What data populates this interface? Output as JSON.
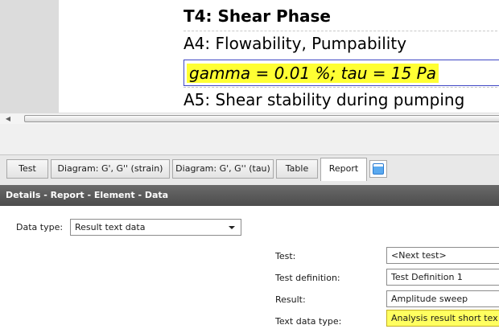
{
  "report_preview": {
    "lines": {
      "title": "T4: Shear Phase",
      "a4": "A4: Flowability, Pumpability",
      "gamma": "gamma = 0.01 %; tau = 15 Pa",
      "a5": "A5: Shear stability during pumping"
    },
    "highlight_color": "#ffff33",
    "selection_color": "#3e46c4"
  },
  "tabs": [
    {
      "label": "Test",
      "active": false
    },
    {
      "label": "Diagram: G', G'' (strain)",
      "active": false
    },
    {
      "label": "Diagram: G', G'' (tau)",
      "active": false
    },
    {
      "label": "Table",
      "active": false
    },
    {
      "label": "Report",
      "active": true
    }
  ],
  "add_tab_icon": "window-icon",
  "details_header": "Details - Report - Element - Data",
  "details": {
    "data_type_label": "Data type:",
    "data_type_value": "Result text data",
    "fields": [
      {
        "label": "Test:",
        "value": "<Next test>"
      },
      {
        "label": "Test definition:",
        "value": "Test Definition 1"
      },
      {
        "label": "Result:",
        "value": "Amplitude sweep"
      },
      {
        "label": "Text data type:",
        "value": "Analysis result short tex"
      }
    ]
  }
}
